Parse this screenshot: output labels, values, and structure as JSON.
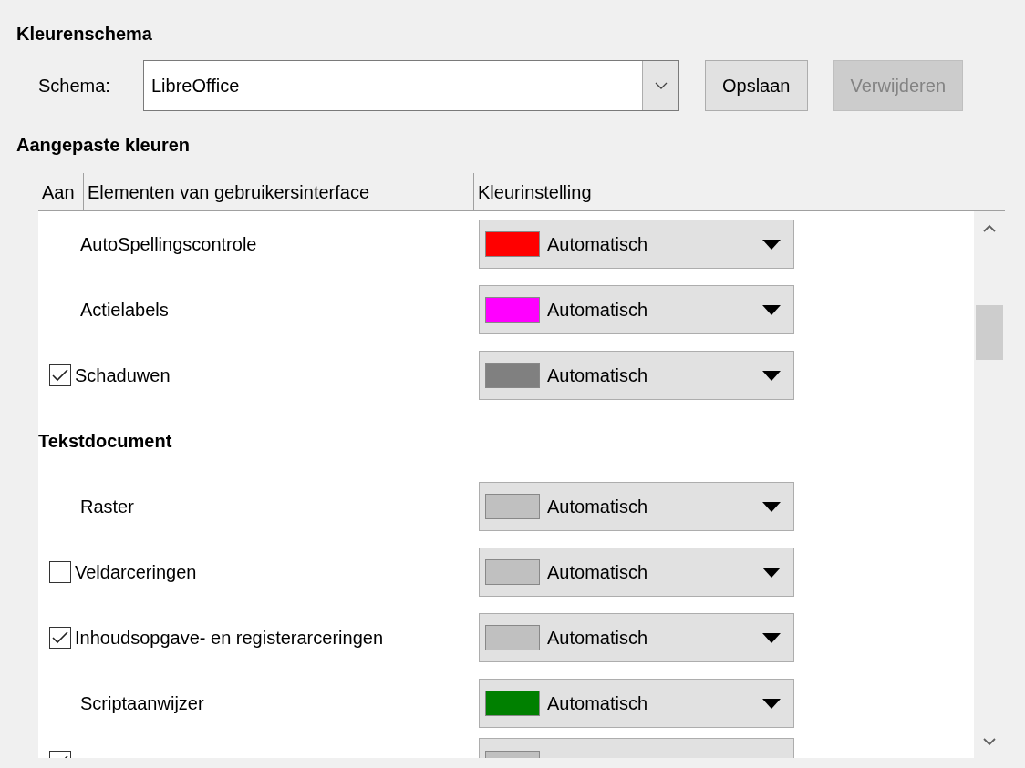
{
  "section_title": "Kleurenschema",
  "scheme": {
    "label": "Schema:",
    "value": "LibreOffice"
  },
  "buttons": [
    {
      "label": "Opslaan",
      "disabled": false
    },
    {
      "label": "Verwijderen",
      "disabled": true
    }
  ],
  "custom_title": "Aangepaste kleuren",
  "table": {
    "columns": [
      "Aan",
      "Elementen van gebruikersinterface",
      "Kleurinstelling"
    ],
    "rows": [
      {
        "kind": "item",
        "label": "AutoSpellingscontrole",
        "color": "#ff0000",
        "setting": "Automatisch"
      },
      {
        "kind": "item",
        "label": "Actielabels",
        "color": "#ff00ff",
        "setting": "Automatisch"
      },
      {
        "kind": "check",
        "checked": true,
        "label": "Schaduwen",
        "color": "#808080",
        "setting": "Automatisch"
      },
      {
        "kind": "heading",
        "label": "Tekstdocument"
      },
      {
        "kind": "item",
        "label": "Raster",
        "color": "#c0c0c0",
        "setting": "Automatisch"
      },
      {
        "kind": "check",
        "checked": false,
        "label": "Veldarceringen",
        "color": "#c0c0c0",
        "setting": "Automatisch"
      },
      {
        "kind": "check",
        "checked": true,
        "label": "Inhoudsopgave- en registerarceringen",
        "color": "#c0c0c0",
        "setting": "Automatisch"
      },
      {
        "kind": "item",
        "label": "Scriptaanwijzer",
        "color": "#008000",
        "setting": "Automatisch"
      },
      {
        "kind": "partial",
        "checked": true,
        "color": "#c0c0c0"
      }
    ]
  }
}
